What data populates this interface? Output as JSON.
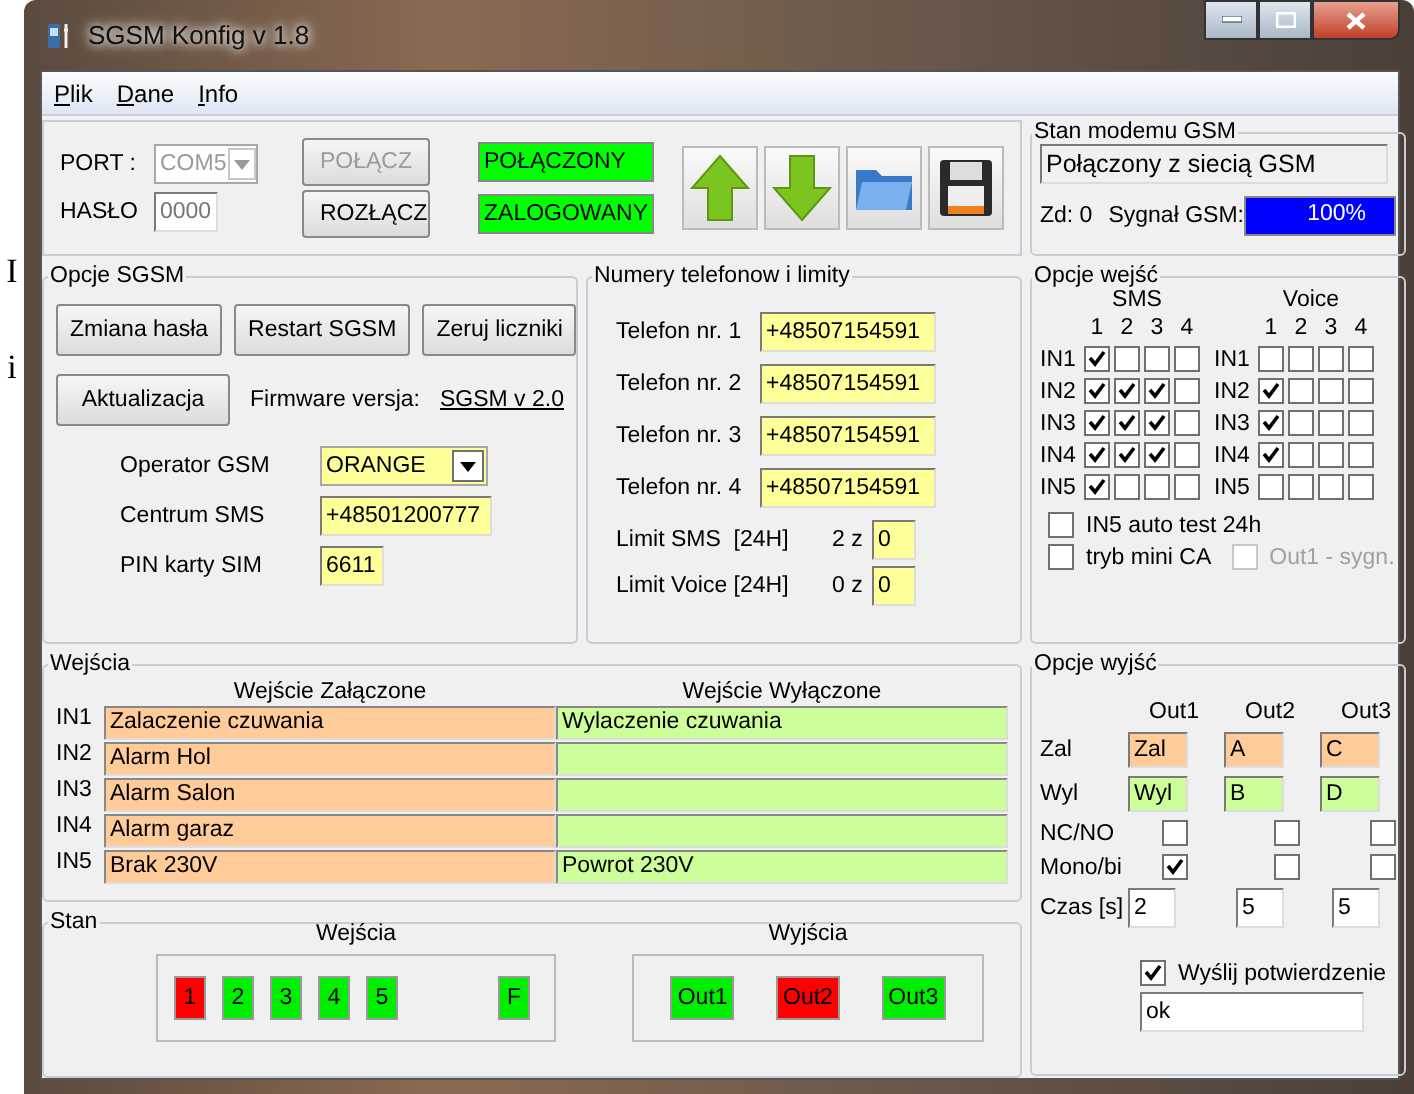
{
  "background_text": [
    "I",
    "i"
  ],
  "window": {
    "title": "SGSM Konfig v 1.8"
  },
  "menu": [
    "Plik",
    "Dane",
    "Info"
  ],
  "connection": {
    "port_label": "PORT :",
    "port": "COM5",
    "port_disabled": true,
    "password_label": "HASŁO",
    "password": "0000",
    "buttons": [
      {
        "label": "POŁĄCZ",
        "disabled": true
      },
      {
        "label": "ROZŁĄCZ",
        "disabled": false
      }
    ],
    "status": [
      "POŁĄCZONY",
      "ZALOGOWANY"
    ]
  },
  "modem": {
    "title": "Stan modemu GSM",
    "status": "Połączony z siecią GSM",
    "counter": "Zd: 0",
    "signal_label": "Sygnał GSM:",
    "signal": "100%",
    "level": 1
  },
  "sgsm_options": {
    "title": "Opcje SGSM",
    "buttons": [
      "Zmiana hasła",
      "Restart SGSM",
      "Zeruj liczniki",
      "Aktualizacja"
    ],
    "firmware_label": "Firmware versja:",
    "firmware": "SGSM v 2.0",
    "fields": [
      {
        "label": "Operator GSM",
        "value": "ORANGE",
        "kind": "dropdown"
      },
      {
        "label": "Centrum SMS",
        "value": "+48501200777",
        "kind": "text"
      },
      {
        "label": "PIN karty SIM",
        "value": "6611",
        "kind": "short"
      }
    ]
  },
  "phones": {
    "title": "Numery telefonow i limity",
    "numbers": [
      {
        "label": "Telefon nr. 1",
        "value": "+48507154591"
      },
      {
        "label": "Telefon nr. 2",
        "value": "+48507154591"
      },
      {
        "label": "Telefon nr. 3",
        "value": "+48507154591"
      },
      {
        "label": "Telefon nr. 4",
        "value": "+48507154591"
      }
    ],
    "limits": [
      {
        "label": "Limit SMS  [24H]",
        "count": "2 z",
        "value": "0"
      },
      {
        "label": "Limit Voice [24H]",
        "count": "0 z",
        "value": "0"
      }
    ]
  },
  "input_options": {
    "title": "Opcje wejść",
    "groups": [
      {
        "label": "SMS",
        "columns": [
          "1",
          "2",
          "3",
          "4"
        ],
        "rows": [
          {
            "label": "IN1",
            "checks": [
              true,
              false,
              false,
              false
            ]
          },
          {
            "label": "IN2",
            "checks": [
              true,
              true,
              true,
              false
            ]
          },
          {
            "label": "IN3",
            "checks": [
              true,
              true,
              true,
              false
            ]
          },
          {
            "label": "IN4",
            "checks": [
              true,
              true,
              true,
              false
            ]
          },
          {
            "label": "IN5",
            "checks": [
              true,
              false,
              false,
              false
            ]
          }
        ]
      },
      {
        "label": "Voice",
        "columns": [
          "1",
          "2",
          "3",
          "4"
        ],
        "rows": [
          {
            "label": "IN1",
            "checks": [
              false,
              false,
              false,
              false
            ]
          },
          {
            "label": "IN2",
            "checks": [
              true,
              false,
              false,
              false
            ]
          },
          {
            "label": "IN3",
            "checks": [
              true,
              false,
              false,
              false
            ]
          },
          {
            "label": "IN4",
            "checks": [
              true,
              false,
              false,
              false
            ]
          },
          {
            "label": "IN5",
            "checks": [
              false,
              false,
              false,
              false
            ]
          }
        ]
      }
    ],
    "options": [
      {
        "label": "IN5 auto test 24h",
        "checked": false,
        "disabled": false
      },
      {
        "label": "tryb mini CA",
        "checked": false,
        "disabled": false
      },
      {
        "label": "Out1 - sygn.",
        "checked": false,
        "disabled": true
      }
    ]
  },
  "inputs": {
    "title": "Wejścia",
    "columns": [
      "Wejście Załączone",
      "Wejście Wyłączone"
    ],
    "rows": [
      {
        "label": "IN1",
        "on": "Zalaczenie czuwania",
        "off": "Wylaczenie czuwania"
      },
      {
        "label": "IN2",
        "on": "Alarm Hol"
      },
      {
        "label": "IN3",
        "on": "Alarm Salon"
      },
      {
        "label": "IN4",
        "on": "Alarm garaz"
      },
      {
        "label": "IN5",
        "on": "Brak 230V",
        "off": "Powrot 230V"
      }
    ]
  },
  "state": {
    "title": "Stan",
    "inputs_label": "Wejścia",
    "inputs": [
      {
        "label": "1",
        "alarm": true,
        "kind": "input"
      },
      {
        "label": "2",
        "alarm": false,
        "kind": "input"
      },
      {
        "label": "3",
        "alarm": false,
        "kind": "input"
      },
      {
        "label": "4",
        "alarm": false,
        "kind": "input"
      },
      {
        "label": "5",
        "alarm": false,
        "kind": "input"
      },
      {
        "label": "F",
        "alarm": false,
        "kind": "fault"
      }
    ],
    "outputs_label": "Wyjścia",
    "outputs": [
      {
        "label": "Out1",
        "alarm": false
      },
      {
        "label": "Out2",
        "alarm": true
      },
      {
        "label": "Out3",
        "alarm": false
      }
    ]
  },
  "output_options": {
    "title": "Opcje wyjść",
    "row_labels": [
      "Zal",
      "Wyl",
      "NC/NO",
      "Mono/bi",
      "Czas [s]"
    ],
    "outputs": [
      {
        "label": "Out1",
        "on": "Zal",
        "off": "Wyl",
        "nc_no": false,
        "mono_bi": true,
        "time": "2"
      },
      {
        "label": "Out2",
        "on": "A",
        "off": "B",
        "nc_no": false,
        "mono_bi": false,
        "time": "5"
      },
      {
        "label": "Out3",
        "on": "C",
        "off": "D",
        "nc_no": false,
        "mono_bi": false,
        "time": "5"
      }
    ],
    "confirm": {
      "label": "Wyślij potwierdzenie",
      "checked": true
    },
    "confirm_text": "ok"
  }
}
